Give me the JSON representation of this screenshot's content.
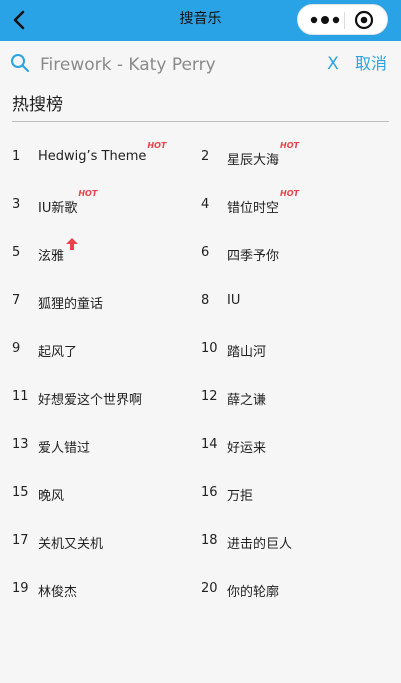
{
  "header": {
    "title": "搜音乐",
    "bg_color": "#29a3e6",
    "back_icon": "chevron-left-icon",
    "more_icon": "more-dots-icon",
    "close_icon": "target-close-icon"
  },
  "search": {
    "placeholder": "Firework - Katy Perry",
    "value": "",
    "clear_label": "X",
    "cancel_label": "取消",
    "accent_color": "#29a3e6"
  },
  "hot_list": {
    "title": "热搜榜",
    "badge_color": "#e8424c",
    "items": [
      {
        "rank": "1",
        "name": "Hedwig’s Theme",
        "badge": "HOT"
      },
      {
        "rank": "2",
        "name": "星辰大海",
        "badge": "HOT"
      },
      {
        "rank": "3",
        "name": "IU新歌",
        "badge": "HOT"
      },
      {
        "rank": "4",
        "name": "错位时空",
        "badge": "HOT"
      },
      {
        "rank": "5",
        "name": "泫雅",
        "badge": "up-arrow"
      },
      {
        "rank": "6",
        "name": "四季予你",
        "badge": ""
      },
      {
        "rank": "7",
        "name": "狐狸的童话",
        "badge": ""
      },
      {
        "rank": "8",
        "name": "IU",
        "badge": ""
      },
      {
        "rank": "9",
        "name": "起风了",
        "badge": ""
      },
      {
        "rank": "10",
        "name": "踏山河",
        "badge": ""
      },
      {
        "rank": "11",
        "name": "好想爱这个世界啊",
        "badge": ""
      },
      {
        "rank": "12",
        "name": "薛之谦",
        "badge": ""
      },
      {
        "rank": "13",
        "name": "爱人错过",
        "badge": ""
      },
      {
        "rank": "14",
        "name": "好运来",
        "badge": ""
      },
      {
        "rank": "15",
        "name": "晚风",
        "badge": ""
      },
      {
        "rank": "16",
        "name": "万拒",
        "badge": ""
      },
      {
        "rank": "17",
        "name": "关机又关机",
        "badge": ""
      },
      {
        "rank": "18",
        "name": "进击的巨人",
        "badge": ""
      },
      {
        "rank": "19",
        "name": "林俊杰",
        "badge": ""
      },
      {
        "rank": "20",
        "name": "你的轮廓",
        "badge": ""
      }
    ]
  }
}
